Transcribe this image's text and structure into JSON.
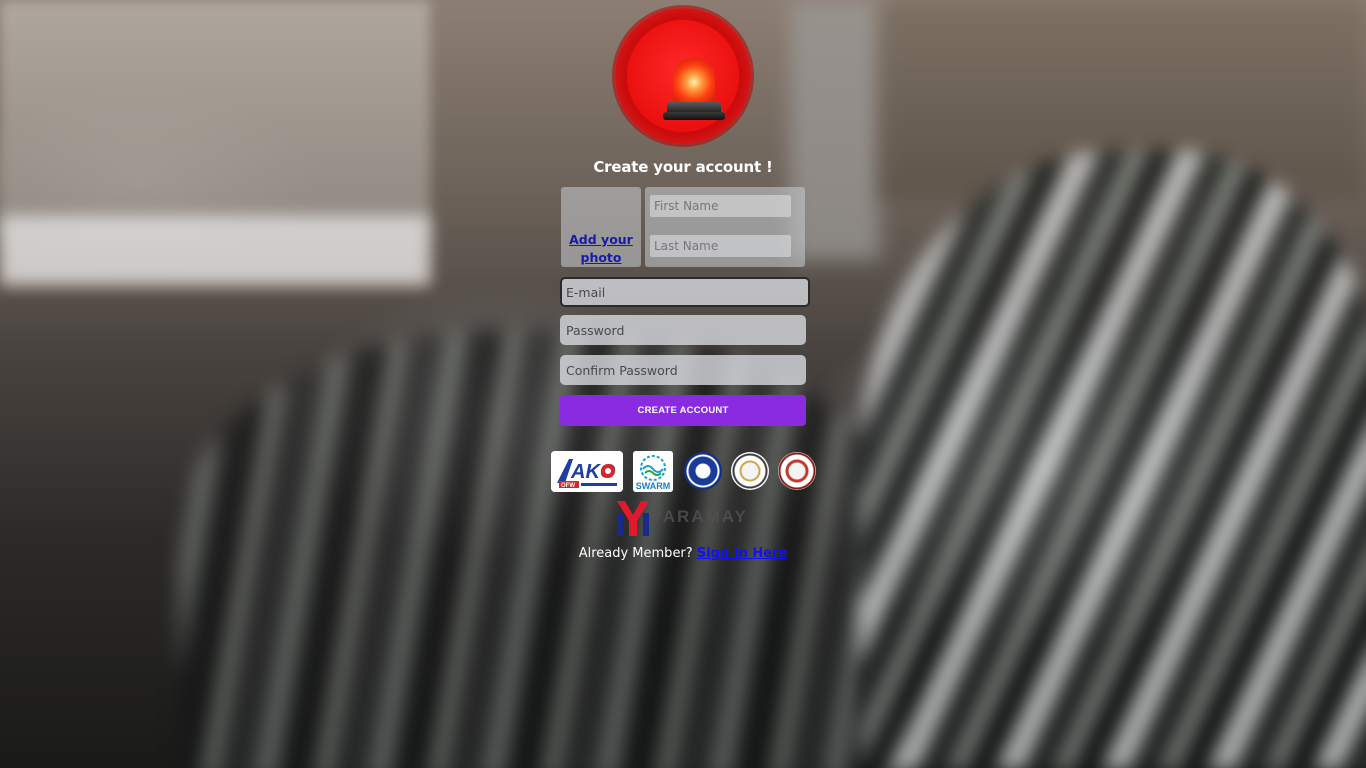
{
  "form": {
    "title": "Create your account !",
    "photo_link": "Add your photo",
    "first_name_placeholder": "First Name",
    "last_name_placeholder": "Last Name",
    "email_placeholder": "E-mail",
    "password_placeholder": "Password",
    "confirm_password_placeholder": "Confirm Password",
    "create_button": "CREATE ACCOUNT"
  },
  "logos": {
    "ako_text": "AKO",
    "ako_sub": "OFW",
    "swarm_text": "SWARM",
    "brand_text": "YARAMAY"
  },
  "footer": {
    "text": "Already Member?",
    "link": "Sign In Here"
  },
  "colors": {
    "accent": "#8a2be2",
    "siren": "#e50d0d",
    "link": "#1010ff"
  }
}
